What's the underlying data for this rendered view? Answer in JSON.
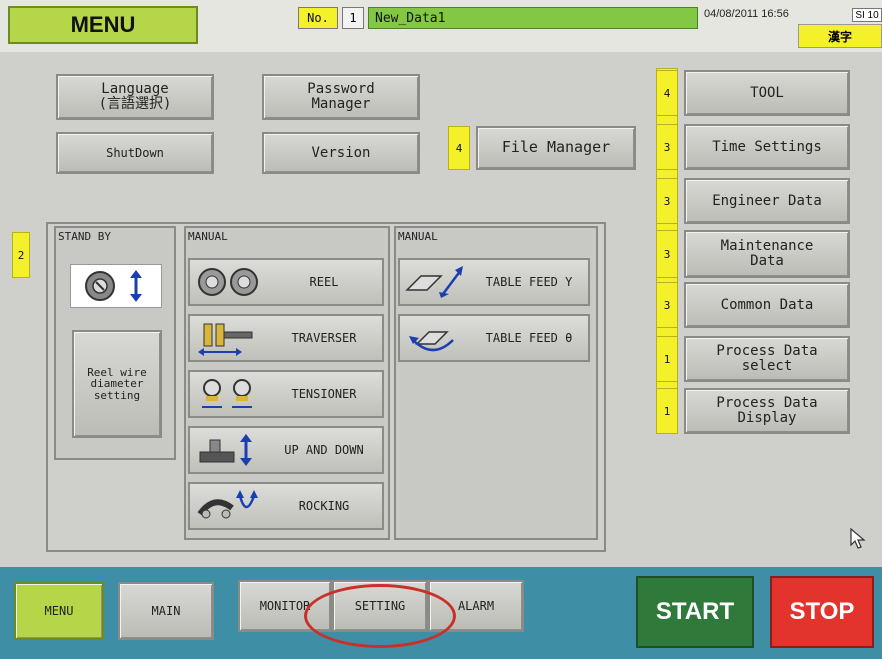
{
  "header": {
    "title": "MENU",
    "no_label": "No.",
    "no_value": "1",
    "data_name": "New_Data1",
    "datetime": "04/08/2011 16:56",
    "si_badge": "SI 10",
    "kanji_label": "漢字"
  },
  "left_buttons": {
    "language": "Language\n(言語選択)",
    "password": "Password\nManager",
    "shutdown": "ShutDown",
    "version": "Version"
  },
  "file_manager": {
    "badge": "4",
    "label": "File Manager"
  },
  "right_buttons": [
    {
      "badge": "4",
      "label": "TOOL"
    },
    {
      "badge": "3",
      "label": "Time Settings"
    },
    {
      "badge": "3",
      "label": "Engineer Data"
    },
    {
      "badge": "3",
      "label": "Maintenance\nData"
    },
    {
      "badge": "3",
      "label": "Common Data"
    },
    {
      "badge": "1",
      "label": "Process Data\nselect"
    },
    {
      "badge": "1",
      "label": "Process Data\nDisplay"
    }
  ],
  "standby": {
    "badge": "2",
    "title": "STAND BY",
    "reel_wire_label": "Reel wire\ndiameter\nsetting"
  },
  "manual1": {
    "title": "MANUAL",
    "items": [
      "REEL",
      "TRAVERSER",
      "TENSIONER",
      "UP AND DOWN",
      "ROCKING"
    ]
  },
  "manual2": {
    "title": "MANUAL",
    "items": [
      "TABLE FEED Y",
      "TABLE FEED θ"
    ]
  },
  "footer": {
    "menu": "MENU",
    "main": "MAIN",
    "monitor": "MONITOR",
    "setting": "SETTING",
    "alarm": "ALARM",
    "start": "START",
    "stop": "STOP"
  },
  "colors": {
    "accent_green": "#b6d64a",
    "data_green": "#83c845",
    "badge_yellow": "#f4f02a",
    "footer_blue": "#3e8fa6",
    "start_green": "#2f7a3b",
    "stop_red": "#e2332c",
    "highlight_ring": "#c9302c"
  }
}
